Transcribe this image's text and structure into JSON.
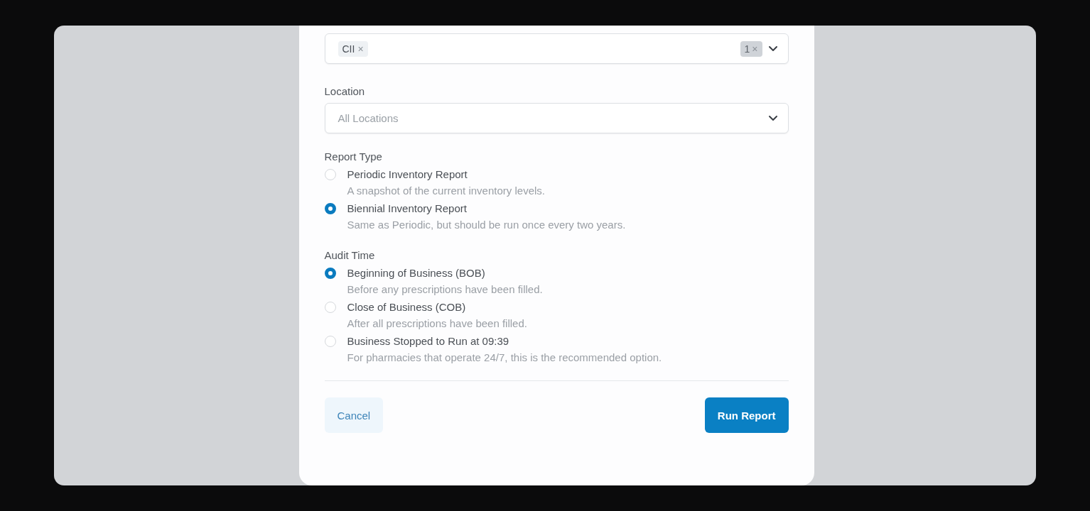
{
  "schedules": {
    "tags": [
      {
        "label": "CII",
        "remove": "×"
      }
    ],
    "count": {
      "label": "1",
      "clear": "×"
    }
  },
  "location": {
    "label": "Location",
    "placeholder": "All Locations"
  },
  "report_type": {
    "label": "Report Type",
    "options": [
      {
        "title": "Periodic Inventory Report",
        "description": "A snapshot of the current inventory levels.",
        "selected": false
      },
      {
        "title": "Biennial Inventory Report",
        "description": "Same as Periodic, but should be run once every two years.",
        "selected": true
      }
    ]
  },
  "audit_time": {
    "label": "Audit Time",
    "options": [
      {
        "title": "Beginning of Business (BOB)",
        "description": "Before any prescriptions have been filled.",
        "selected": true
      },
      {
        "title": "Close of Business (COB)",
        "description": "After all prescriptions have been filled.",
        "selected": false
      },
      {
        "title": "Business Stopped to Run at 09:39",
        "description": "For pharmacies that operate 24/7, this is the recommended option.",
        "selected": false
      }
    ]
  },
  "buttons": {
    "cancel": "Cancel",
    "submit": "Run Report"
  }
}
